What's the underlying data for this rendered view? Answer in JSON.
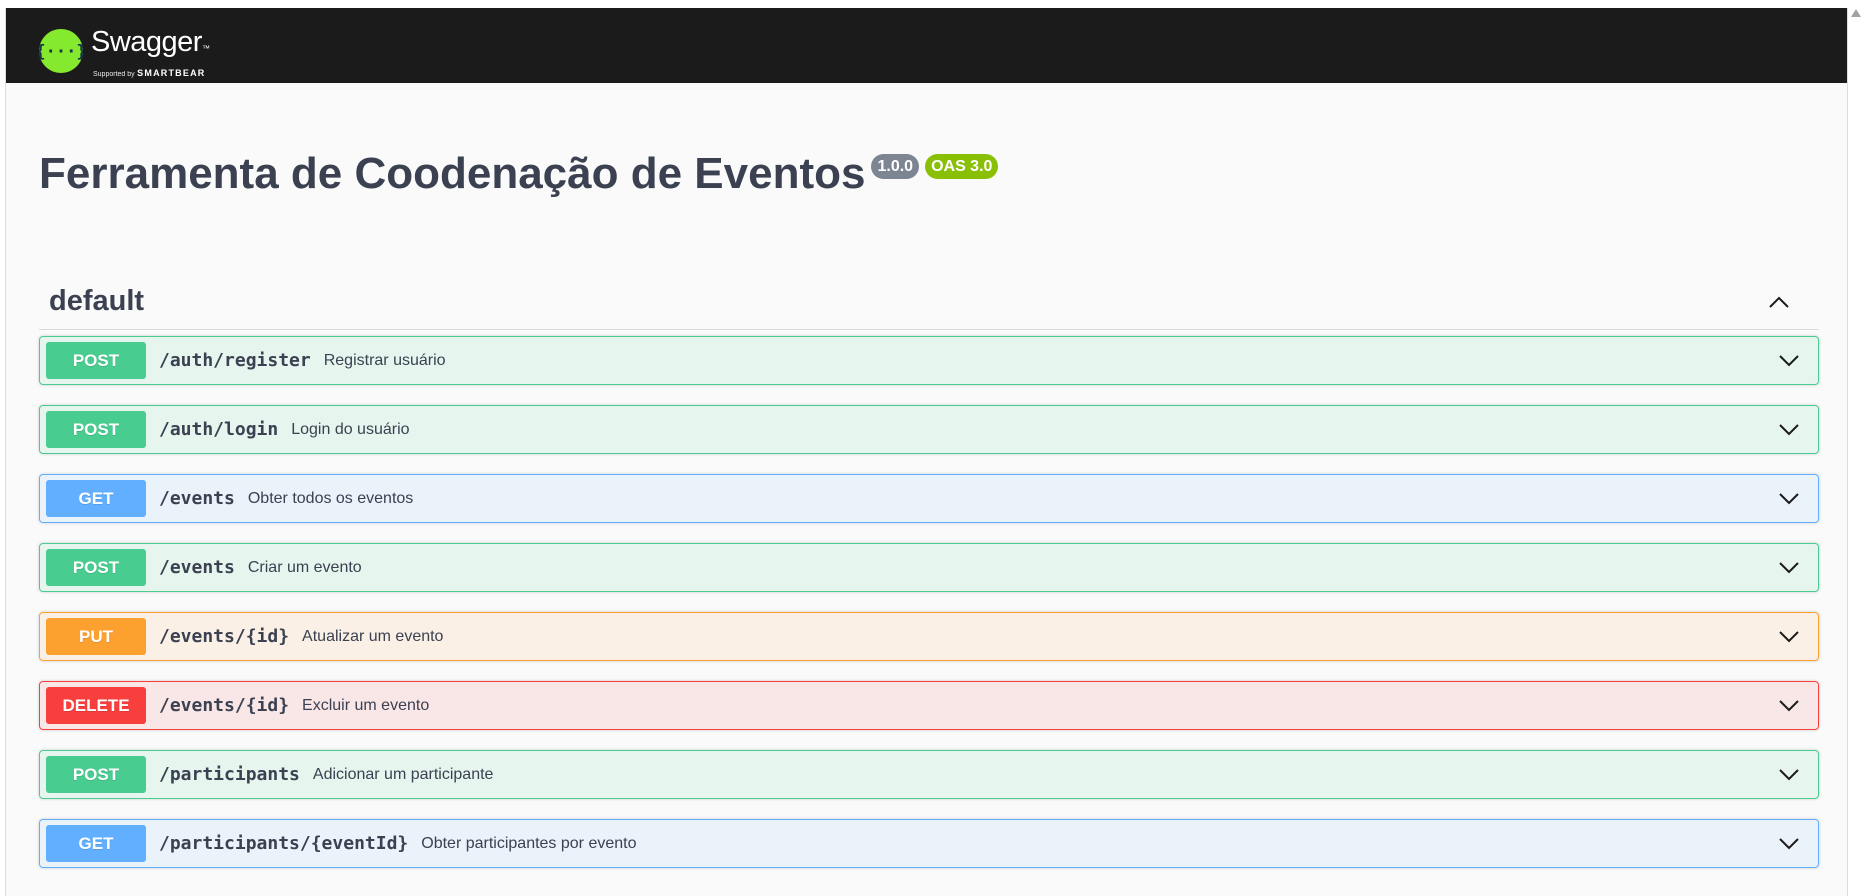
{
  "topbar": {
    "logo_title": "Swagger",
    "logo_tm": "™",
    "logo_supported": "Supported by",
    "logo_brand": "SMARTBEAR",
    "logo_color": "#85ea2d",
    "logo_icon": "swagger-logo-icon",
    "background": "#1b1b1b"
  },
  "info": {
    "title": "Ferramenta de Coodenação de Eventos",
    "version": "1.0.0",
    "oas": "OAS 3.0"
  },
  "tag": {
    "name": "default",
    "toggle_icon": "chevron-up-icon"
  },
  "operations": [
    {
      "method": "POST",
      "path": "/auth/register",
      "summary": "Registrar usuário"
    },
    {
      "method": "POST",
      "path": "/auth/login",
      "summary": "Login do usuário"
    },
    {
      "method": "GET",
      "path": "/events",
      "summary": "Obter todos os eventos"
    },
    {
      "method": "POST",
      "path": "/events",
      "summary": "Criar um evento"
    },
    {
      "method": "PUT",
      "path": "/events/{id}",
      "summary": "Atualizar um evento"
    },
    {
      "method": "DELETE",
      "path": "/events/{id}",
      "summary": "Excluir um evento"
    },
    {
      "method": "POST",
      "path": "/participants",
      "summary": "Adicionar um participante"
    },
    {
      "method": "GET",
      "path": "/participants/{eventId}",
      "summary": "Obter participantes por evento"
    }
  ],
  "method_colors": {
    "POST": "#49cc90",
    "GET": "#61affe",
    "PUT": "#fca130",
    "DELETE": "#f93e3e"
  }
}
